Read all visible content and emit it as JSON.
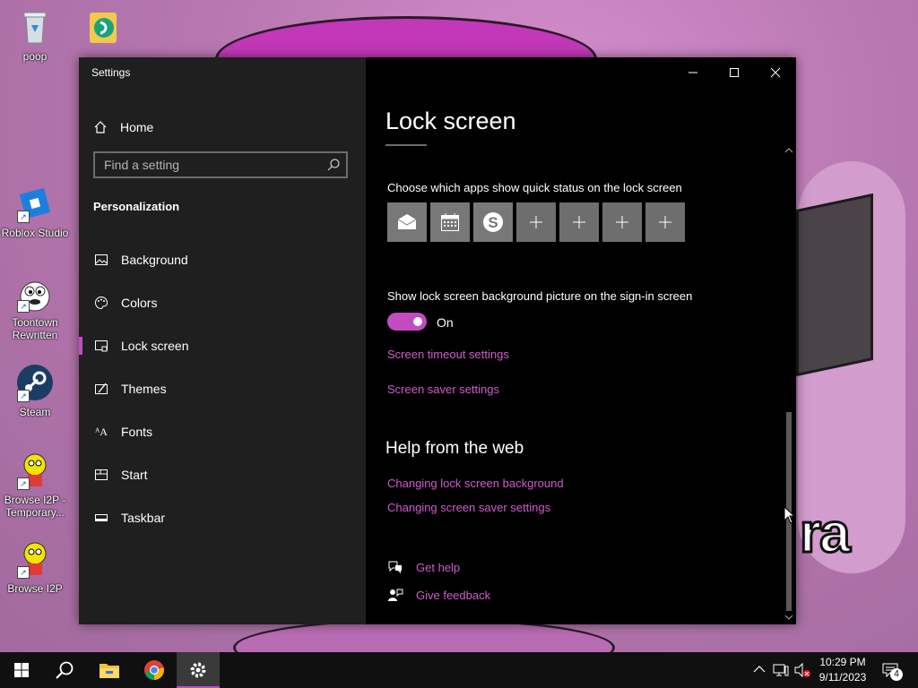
{
  "desktop": {
    "icons": [
      {
        "label": "poop",
        "icon": "recycle-bin-icon"
      },
      {
        "label": "Roblox Studio",
        "icon": "roblox-studio-icon"
      },
      {
        "label": "Toontown Rewritten",
        "icon": "toontown-icon"
      },
      {
        "label": "Steam",
        "icon": "steam-icon"
      },
      {
        "label": "Browse I2P - Temporary...",
        "icon": "i2p-icon"
      },
      {
        "label": "Browse I2P",
        "icon": "i2p-icon"
      }
    ],
    "wallpaper_text": "ra"
  },
  "window": {
    "title": "Settings",
    "home_label": "Home",
    "search_placeholder": "Find a setting",
    "section": "Personalization",
    "nav": [
      {
        "label": "Background",
        "icon": "picture-icon"
      },
      {
        "label": "Colors",
        "icon": "palette-icon"
      },
      {
        "label": "Lock screen",
        "icon": "lock-screen-icon",
        "active": true
      },
      {
        "label": "Themes",
        "icon": "brush-icon"
      },
      {
        "label": "Fonts",
        "icon": "font-icon"
      },
      {
        "label": "Start",
        "icon": "start-icon"
      },
      {
        "label": "Taskbar",
        "icon": "taskbar-icon"
      }
    ]
  },
  "content": {
    "title": "Lock screen",
    "quick_status_label": "Choose which apps show quick status on the lock screen",
    "quick_status_apps": [
      "mail-icon",
      "calendar-icon",
      "skype-icon",
      "add-icon",
      "add-icon",
      "add-icon",
      "add-icon"
    ],
    "signin_label": "Show lock screen background picture on the sign-in screen",
    "toggle_state": "On",
    "toggle_on": true,
    "screen_timeout_link": "Screen timeout settings",
    "screen_saver_link": "Screen saver settings",
    "help_heading": "Help from the web",
    "help_links": [
      "Changing lock screen background",
      "Changing screen saver settings"
    ],
    "get_help": "Get help",
    "give_feedback": "Give feedback"
  },
  "taskbar": {
    "time": "10:29 PM",
    "date": "9/11/2023",
    "notification_count": "4",
    "pinned": [
      "windows-start-icon",
      "search-icon",
      "file-explorer-icon",
      "chrome-icon",
      "settings-icon"
    ]
  },
  "colors": {
    "accent": "#c14bc1",
    "link": "#d05ccd",
    "sidebar_bg": "#1f1f1f",
    "content_bg": "#000000"
  }
}
